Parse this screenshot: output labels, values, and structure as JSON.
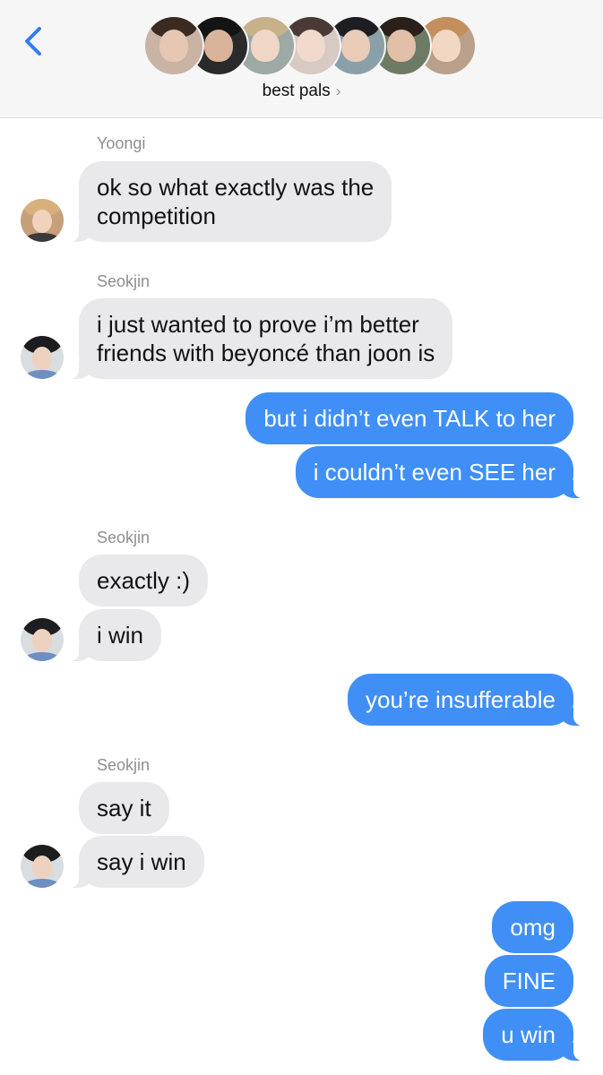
{
  "header": {
    "group_name": "best pals",
    "chevron": "›",
    "colors": {
      "background": "#f6f6f6",
      "back_arrow": "#2f7cf6"
    },
    "participants": [
      {
        "icon": "participant-avatar-1",
        "bg": "#c9b3a5",
        "hair": "#3a2a22",
        "face": "#e6c7b4"
      },
      {
        "icon": "participant-avatar-2",
        "bg": "#2a2a2a",
        "hair": "#141414",
        "face": "#d9b49a"
      },
      {
        "icon": "participant-avatar-3",
        "bg": "#9ea8a4",
        "hair": "#c7b18a",
        "face": "#f0d6c4"
      },
      {
        "icon": "participant-avatar-4",
        "bg": "#d7c9c3",
        "hair": "#4a3a35",
        "face": "#f1d9cc"
      },
      {
        "icon": "participant-avatar-5",
        "bg": "#8aa0a8",
        "hair": "#1e1e22",
        "face": "#e8ccb8"
      },
      {
        "icon": "participant-avatar-6",
        "bg": "#6d7b64",
        "hair": "#2a1f1b",
        "face": "#e2c0a8"
      },
      {
        "icon": "participant-avatar-7",
        "bg": "#b9a08a",
        "hair": "#c48f5c",
        "face": "#f2d8c2"
      }
    ]
  },
  "colors": {
    "incoming": "#e9e9eb",
    "outgoing": "#3f8ff7",
    "sender": "#8e8e93"
  },
  "messages": [
    {
      "type": "sender",
      "name": "Yoongi"
    },
    {
      "type": "in",
      "lines": [
        "ok so what exactly was the",
        "competition"
      ],
      "tail": true,
      "avatar": "yoongi-avatar"
    },
    {
      "type": "sender",
      "name": "Seokjin"
    },
    {
      "type": "in",
      "lines": [
        "i just wanted to prove i’m better",
        "friends with beyoncé than joon is"
      ],
      "tail": true,
      "avatar": "seokjin-avatar"
    },
    {
      "type": "out",
      "text": "but i didn’t even TALK to her"
    },
    {
      "type": "out",
      "text": "i couldn’t even SEE her",
      "tail": true
    },
    {
      "type": "sender",
      "name": "Seokjin"
    },
    {
      "type": "in",
      "text": "exactly :)"
    },
    {
      "type": "in",
      "text": "i win",
      "tail": true,
      "avatar": "seokjin-avatar"
    },
    {
      "type": "out",
      "text": "you’re insufferable",
      "tail": true
    },
    {
      "type": "sender",
      "name": "Seokjin"
    },
    {
      "type": "in",
      "text": "say it"
    },
    {
      "type": "in",
      "text": "say i win",
      "tail": true,
      "avatar": "seokjin-avatar"
    },
    {
      "type": "out",
      "text": "omg"
    },
    {
      "type": "out",
      "text": "FINE"
    },
    {
      "type": "out",
      "text": "u win",
      "tail": true
    }
  ],
  "avatars": {
    "yoongi-avatar": {
      "bg": "#c79f7a",
      "hair": "#d8b07c",
      "face": "#f0d2bd",
      "shirt": "#3a3a3a"
    },
    "seokjin-avatar": {
      "bg": "#d9dde0",
      "hair": "#1d1d20",
      "face": "#ecd2bf",
      "shirt": "#6d8fc2"
    }
  }
}
